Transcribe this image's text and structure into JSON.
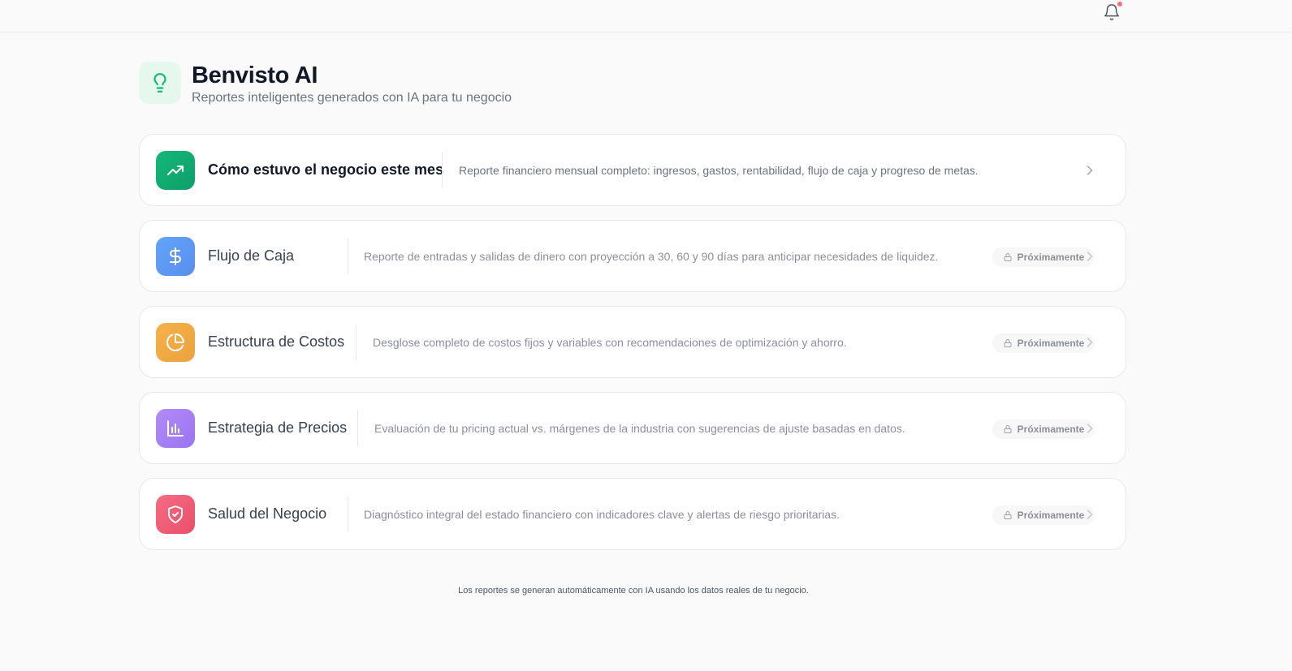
{
  "topbar": {
    "notification_icon": "bell-icon",
    "has_unread": true
  },
  "header": {
    "icon": "lightbulb-icon",
    "title": "Benvisto AI",
    "subtitle": "Reportes inteligentes generados con IA para tu negocio"
  },
  "reports": [
    {
      "title": "Cómo estuvo el negocio este mes",
      "description": "Reporte financiero mensual completo: ingresos, gastos, rentabilidad, flujo de caja y progreso de metas.",
      "icon": "trending-up-icon",
      "color": "#10b981",
      "status": ""
    },
    {
      "title": "Flujo de Caja",
      "description": "Reporte de entradas y salidas de dinero con proyección a 30, 60 y 90 días para anticipar necesidades de liquidez.",
      "icon": "dollar-icon",
      "color": "#60a5fa",
      "status": "Próximamente"
    },
    {
      "title": "Estructura de Costos",
      "description": "Desglose completo de costos fijos y variables con recomendaciones de optimización y ahorro.",
      "icon": "pie-chart-icon",
      "color": "#f59e0b",
      "status": "Próximamente"
    },
    {
      "title": "Estrategia de Precios",
      "description": "Evaluación de tu pricing actual vs. márgenes de la industria con sugerencias de ajuste basadas en datos.",
      "icon": "bar-chart-icon",
      "color": "#a78bfa",
      "status": "Próximamente"
    },
    {
      "title": "Salud del Negocio",
      "description": "Diagnóstico integral del estado financiero con indicadores clave y alertas de riesgo prioritarias.",
      "icon": "shield-check-icon",
      "color": "#f05a73",
      "status": "Próximamente"
    }
  ],
  "footer": {
    "note": "Los reportes se generan automáticamente con IA usando los datos reales de tu negocio."
  }
}
